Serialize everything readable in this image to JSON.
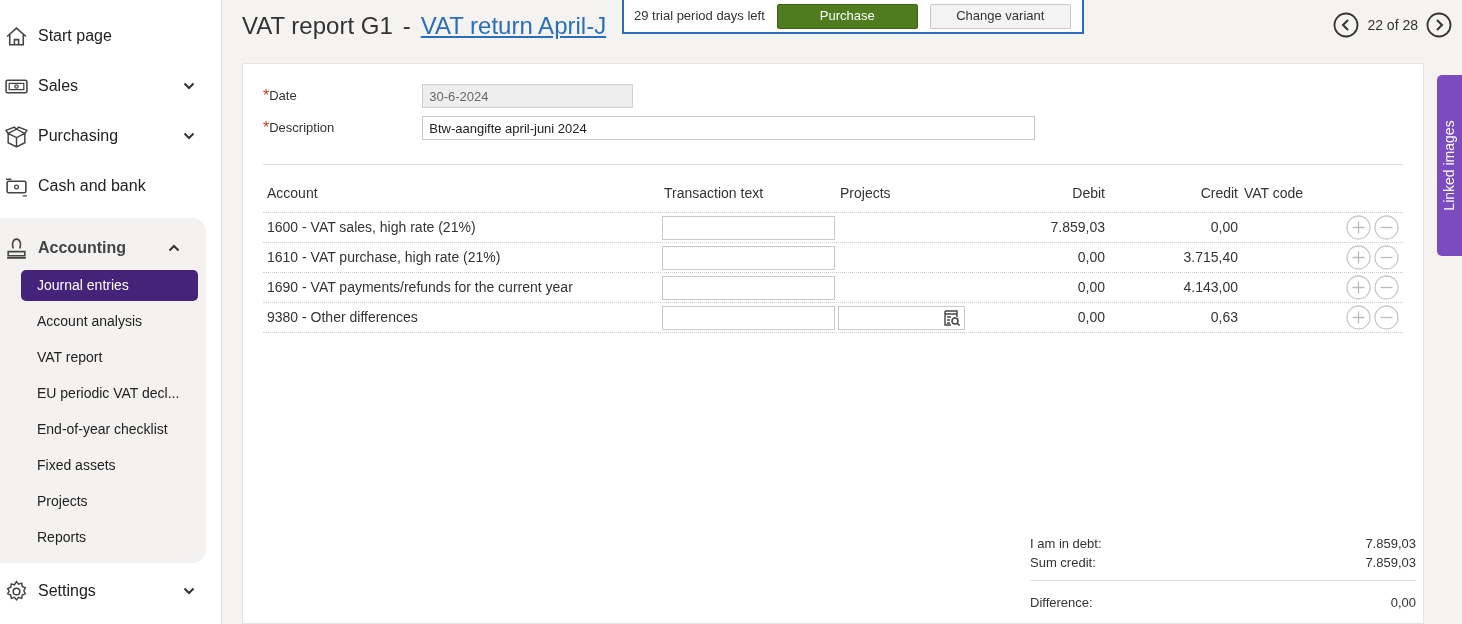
{
  "sidebar": {
    "items": [
      {
        "label": "Start page",
        "kind": "link"
      },
      {
        "label": "Sales",
        "kind": "group",
        "expanded": false
      },
      {
        "label": "Purchasing",
        "kind": "group",
        "expanded": false
      },
      {
        "label": "Cash and bank",
        "kind": "link"
      },
      {
        "label": "Accounting",
        "kind": "group",
        "expanded": true,
        "children": [
          {
            "label": "Journal entries",
            "selected": true
          },
          {
            "label": "Account analysis",
            "selected": false
          },
          {
            "label": "VAT report",
            "selected": false
          },
          {
            "label": "EU periodic VAT decl...",
            "selected": false
          },
          {
            "label": "End-of-year checklist",
            "selected": false
          },
          {
            "label": "Fixed assets",
            "selected": false
          },
          {
            "label": "Projects",
            "selected": false
          },
          {
            "label": "Reports",
            "selected": false
          }
        ]
      },
      {
        "label": "Settings",
        "kind": "group",
        "expanded": false
      }
    ]
  },
  "header": {
    "title": "VAT report G1",
    "separator": "-",
    "link": "VAT return April-J",
    "pager": "22 of 28"
  },
  "trial_banner": {
    "text": "29 trial period days left",
    "buttons": [
      "Purchase",
      "Change variant"
    ]
  },
  "form": {
    "fields": [
      {
        "marker": "*",
        "label": "Date",
        "value": "30-6-2024",
        "disabled": true
      },
      {
        "marker": "*",
        "label": "Description",
        "value": "Btw-aangifte april-juni 2024",
        "disabled": false
      }
    ]
  },
  "table": {
    "columns": [
      "Account",
      "Transaction text",
      "Projects",
      "Debit",
      "Credit",
      "VAT code"
    ],
    "rows": [
      {
        "account": "1600 - VAT sales, high rate (21%)",
        "project_field": false,
        "debit": "7.859,03",
        "credit": "0,00"
      },
      {
        "account": "1610 - VAT purchase, high rate (21%)",
        "project_field": false,
        "debit": "0,00",
        "credit": "3.715,40"
      },
      {
        "account": "1690 - VAT payments/refunds for the current year",
        "project_field": false,
        "debit": "0,00",
        "credit": "4.143,00"
      },
      {
        "account": "9380 - Other differences",
        "project_field": true,
        "debit": "0,00",
        "credit": "0,63"
      }
    ]
  },
  "totals": [
    {
      "label": "I am in debt:",
      "value": "7.859,03",
      "divider": false
    },
    {
      "label": "Sum credit:",
      "value": "7.859,03",
      "divider": false
    },
    {
      "label": "Difference:",
      "value": "0,00",
      "divider": true
    }
  ],
  "side_tab": {
    "label": "Linked images"
  }
}
